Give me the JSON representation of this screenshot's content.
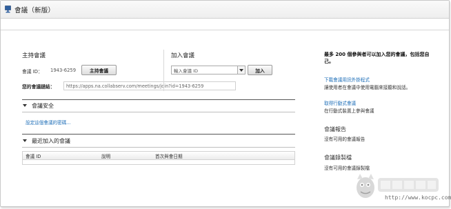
{
  "window": {
    "title": "會議（新版）",
    "app_icon": "meeting-app-icon"
  },
  "host_section": {
    "heading": "主持會議",
    "meeting_id_label": "會議 ID：",
    "meeting_id_value": "1943-6259",
    "host_button_label": "主持會議",
    "link_label": "您的會議鏈結：",
    "link_value": "https://apps.na.collabserv.com/meetings/join?id=1943-6259"
  },
  "join_section": {
    "heading": "加入會議",
    "input_placeholder": "輸入會議 ID",
    "join_button_label": "加入"
  },
  "security_section": {
    "heading": "會議安全",
    "password_link": "設定這個會議的密碼..."
  },
  "recent_section": {
    "heading": "最近加入的會議",
    "columns": [
      "會議 ID",
      "說明",
      "首次與會日期"
    ]
  },
  "side_panel": {
    "capacity_text_line1": "最多 200 個參與者可以加入您的會議，包括您自",
    "capacity_text_line2": "己。",
    "plugin_link": "下載會議用訊外掛程式",
    "plugin_desc": "讓使用者在會議中使用電腦來接聽和說話。",
    "mobile_link": "取得行動式會議",
    "mobile_desc": "在行動式裝置上參與會議",
    "reports_heading": "會議報告",
    "reports_empty": "沒有可用的會議報告",
    "recordings_heading": "會議錄製檔",
    "recordings_empty": "沒有可用的會議錄製檔"
  },
  "watermark": {
    "logo_text": "電腦王阿達",
    "url": "http://www.kocpc.com.tw"
  },
  "colors": {
    "link": "#1f6fb8",
    "app_icon": "#2f5f9f"
  }
}
